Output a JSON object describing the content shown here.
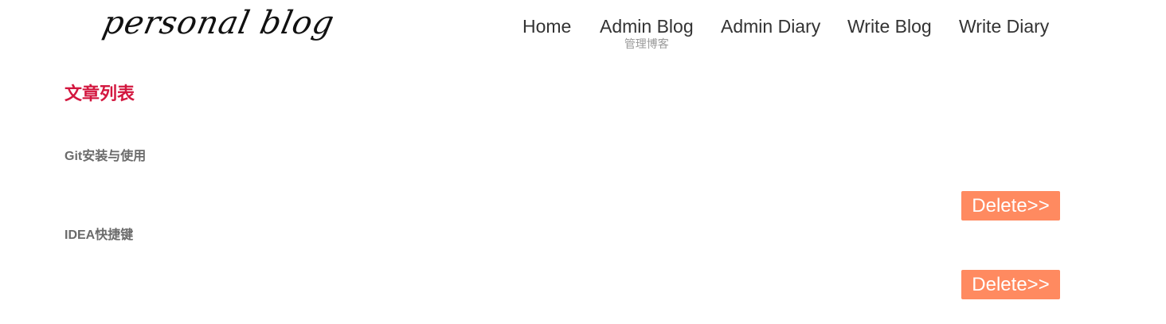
{
  "logo": {
    "text": "personal blog"
  },
  "nav": {
    "items": [
      {
        "label": "Home"
      },
      {
        "label": "Admin Blog",
        "sub": "管理博客"
      },
      {
        "label": "Admin Diary"
      },
      {
        "label": "Write Blog"
      },
      {
        "label": "Write Diary"
      }
    ]
  },
  "main": {
    "section_title": "文章列表",
    "articles": [
      {
        "title": "Git安装与使用",
        "delete_label": "Delete>>"
      },
      {
        "title": "IDEA快捷键",
        "delete_label": "Delete>>"
      }
    ]
  },
  "colors": {
    "accent_red": "#d3173f",
    "delete_button": "#ff8a60"
  }
}
